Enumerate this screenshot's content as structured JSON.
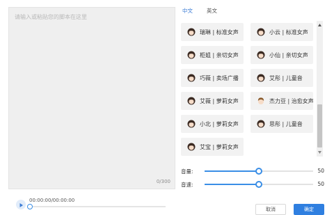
{
  "editor": {
    "placeholder": "请输入或粘贴您的脚本在这里",
    "char_count": "0/300"
  },
  "language_tabs": {
    "chinese": "中文",
    "english": "英文"
  },
  "voices": [
    {
      "label": "瑞琳 | 标准女声",
      "avatar": "female-avatar-icon"
    },
    {
      "label": "小云 | 标准女声",
      "avatar": "female-avatar-icon"
    },
    {
      "label": "柜姐 | 亲切女声",
      "avatar": "female-avatar-icon"
    },
    {
      "label": "小仙 | 亲切女声",
      "avatar": "female-avatar-icon"
    },
    {
      "label": "巧薇 | 卖场广播",
      "avatar": "female-avatar-icon"
    },
    {
      "label": "艾彤 | 儿童音",
      "avatar": "female-avatar-icon"
    },
    {
      "label": "艾薇 | 萝莉女声",
      "avatar": "female-avatar-icon"
    },
    {
      "label": "杰力豆 | 治愈女声",
      "avatar": "male-avatar-icon"
    },
    {
      "label": "小北 | 萝莉女声",
      "avatar": "female-avatar-icon"
    },
    {
      "label": "思彤 | 儿童音",
      "avatar": "female-avatar-icon"
    },
    {
      "label": "艾宝 | 萝莉女声",
      "avatar": "female-avatar-icon"
    }
  ],
  "controls": {
    "volume": {
      "label": "音量:",
      "value": 50
    },
    "speed": {
      "label": "音速:",
      "value": 50
    }
  },
  "player": {
    "time": "00:00:00/00:00:00",
    "progress": 0
  },
  "buttons": {
    "secondary": "取消",
    "primary": "确定"
  },
  "colors": {
    "accent": "#3a8ee6",
    "primary_button": "#2f7fe0",
    "card_bg": "#f2f2f2",
    "editor_bg": "#efefef"
  }
}
